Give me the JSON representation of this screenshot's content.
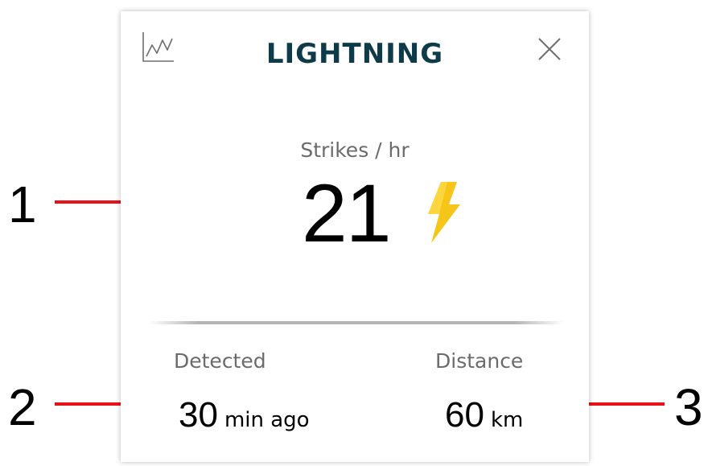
{
  "widget": {
    "title": "LIGHTNING",
    "rate_label": "Strikes / hr",
    "rate_value": "21",
    "detected_label": "Detected",
    "detected_value": "30",
    "detected_unit": "min ago",
    "distance_label": "Distance",
    "distance_value": "60",
    "distance_unit": "km",
    "icons": {
      "chart": "line-chart-icon",
      "close": "close-icon",
      "bolt": "lightning-bolt-icon"
    },
    "colors": {
      "title": "#0e3b4a",
      "bolt": "#f5c518",
      "label": "#6b6b6b"
    }
  },
  "annotations": {
    "callouts": [
      {
        "number": "1",
        "target": "rate_value"
      },
      {
        "number": "2",
        "target": "detected_value"
      },
      {
        "number": "3",
        "target": "distance_value"
      }
    ],
    "line_color": "#e8121a"
  }
}
